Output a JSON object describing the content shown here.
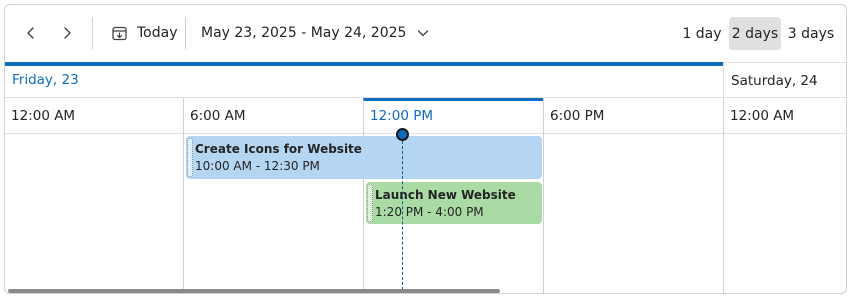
{
  "toolbar": {
    "prev_icon": "chevron-left-icon",
    "next_icon": "chevron-right-icon",
    "today_icon": "calendar-today-icon",
    "today_label": "Today",
    "date_range": "May 23, 2025 - May 24, 2025",
    "range_dropdown_icon": "chevron-down-icon",
    "views": [
      {
        "label": "1 day",
        "active": false
      },
      {
        "label": "2 days",
        "active": true
      },
      {
        "label": "3 days",
        "active": false
      }
    ]
  },
  "days": [
    {
      "label": "Friday, 23",
      "is_today": true
    },
    {
      "label": "Saturday, 24",
      "is_today": false
    }
  ],
  "time_slots": [
    "12:00 AM",
    "6:00 AM",
    "12:00 PM",
    "6:00 PM",
    "12:00 AM"
  ],
  "events": [
    {
      "title": "Create Icons for Website",
      "time": "10:00 AM - 12:30 PM",
      "color": "#b5d6f2"
    },
    {
      "title": "Launch New Website",
      "time": "1:20 PM - 4:00 PM",
      "color": "#aadba5"
    }
  ],
  "colors": {
    "accent": "#0f6cbd",
    "view_active_bg": "#e0e0e0"
  }
}
